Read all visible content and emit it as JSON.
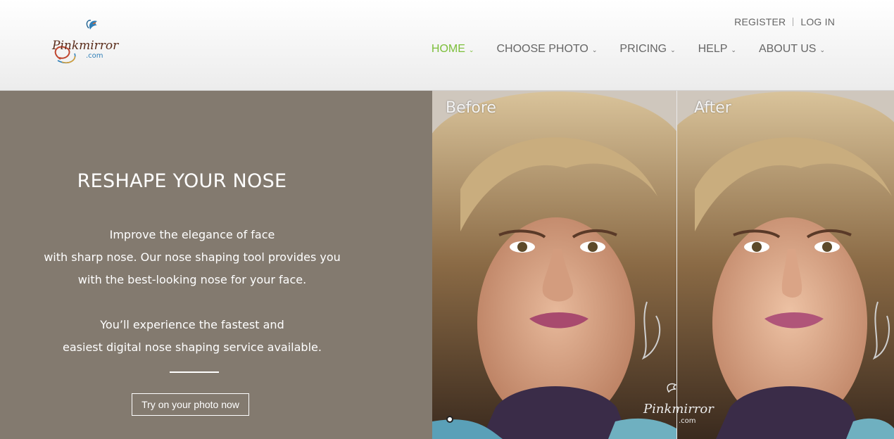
{
  "brand": {
    "logo_text": "Pinkmirror",
    "logo_suffix": ".com"
  },
  "account": {
    "register": "REGISTER",
    "login": "LOG IN"
  },
  "nav": {
    "items": [
      {
        "label": "HOME",
        "active": true
      },
      {
        "label": "CHOOSE PHOTO",
        "active": false
      },
      {
        "label": "PRICING",
        "active": false
      },
      {
        "label": "HELP",
        "active": false
      },
      {
        "label": "ABOUT US",
        "active": false
      }
    ],
    "active_color": "#7cbf3a",
    "text_color": "#666666",
    "chevron_icon": "chevron-down-icon"
  },
  "promo": {
    "title": "RESHAPE YOUR NOSE",
    "paragraph1_line1": "Improve the elegance of face",
    "paragraph1_line2": "with sharp nose. Our nose shaping tool provides you",
    "paragraph1_line3": "with the best-looking nose for your face.",
    "paragraph2_line1": "You’ll experience the fastest and",
    "paragraph2_line2": "easiest digital nose shaping service available.",
    "cta_label": "Try on your photo now",
    "background": "#837a6f"
  },
  "comparison": {
    "before_label": "Before",
    "after_label": "After",
    "watermark_text": "Pinkmirror",
    "watermark_suffix": ".com"
  }
}
